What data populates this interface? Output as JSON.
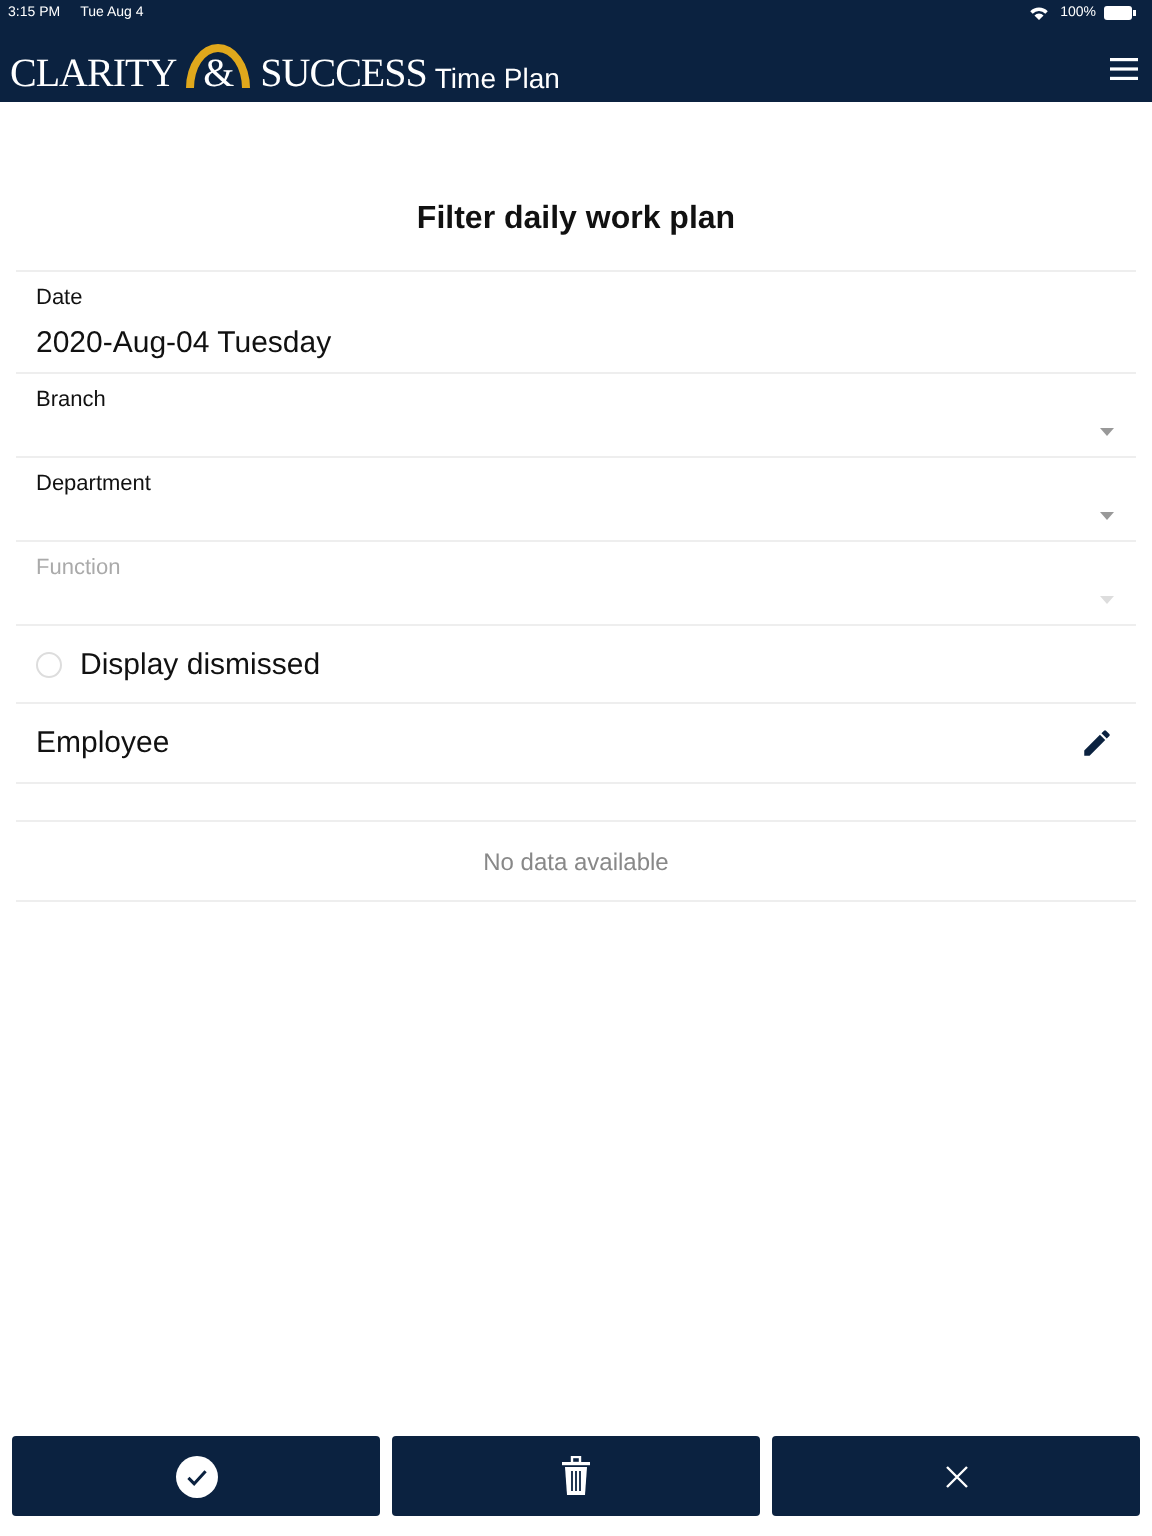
{
  "status_bar": {
    "time": "3:15 PM",
    "date": "Tue Aug 4",
    "battery": "100%"
  },
  "header": {
    "logo": [
      "CLARITY",
      "&",
      "SUCCESS"
    ],
    "subtitle": "Time Plan"
  },
  "title": "Filter daily work plan",
  "fields": [
    {
      "kind": "text",
      "label": "Date",
      "value": "2020-Aug-04 Tuesday",
      "disabled": false
    },
    {
      "kind": "select",
      "label": "Branch",
      "disabled": false
    },
    {
      "kind": "select",
      "label": "Department",
      "disabled": false
    },
    {
      "kind": "select",
      "label": "Function",
      "disabled": true
    }
  ],
  "dismissed": {
    "label": "Display dismissed",
    "checked": false
  },
  "employee": {
    "label": "Employee"
  },
  "table": {
    "empty_text": "No data available"
  },
  "buttons": [
    {
      "kind": "confirm"
    },
    {
      "kind": "delete"
    },
    {
      "kind": "close"
    }
  ]
}
